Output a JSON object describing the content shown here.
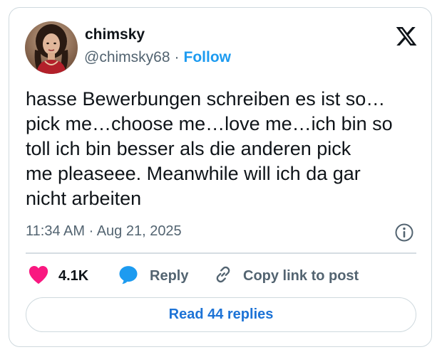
{
  "author": {
    "display_name": "chimsky",
    "handle": "@chimsky68",
    "separator": "·",
    "follow_label": "Follow",
    "avatar_icon": "profile-photo"
  },
  "platform_logo": "x-logo-icon",
  "tweet": {
    "text": "hasse Bewerbungen schreiben es ist so…\npick me…choose me…love me…ich bin so\ntoll ich bin besser als die anderen pick\nme pleaseee. Meanwhile will ich da gar\nnicht arbeiten",
    "timestamp": "11:34 AM · Aug 21, 2025"
  },
  "actions": {
    "like_count": "4.1K",
    "reply_label": "Reply",
    "copy_label": "Copy link to post"
  },
  "read_replies_label": "Read 44 replies",
  "colors": {
    "accent": "#1d9bf0",
    "like": "#f91880",
    "reply_icon": "#1d9bf0",
    "border": "#cfd9de",
    "muted_text": "#536471"
  }
}
